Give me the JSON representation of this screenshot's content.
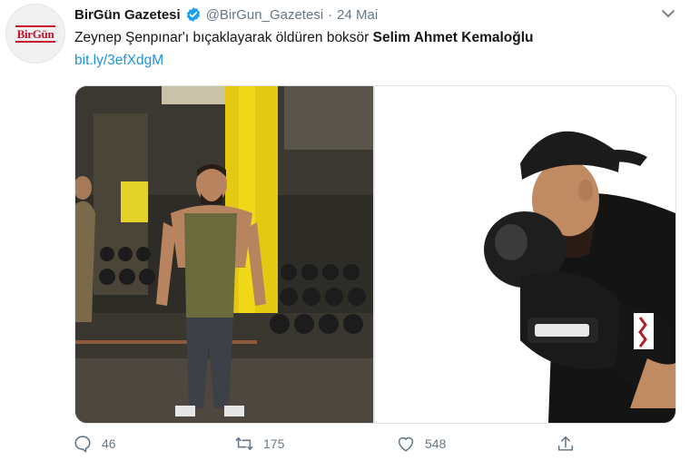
{
  "author": {
    "display_name": "BirGün Gazetesi",
    "handle": "@BirGun_Gazetesi",
    "separator": "·",
    "date": "24 Mai",
    "avatar_text": "BirGün"
  },
  "tweet": {
    "text_prefix": "Zeynep Şenpınar'ı bıçaklayarak öldüren boksör ",
    "text_bold": "Selim Ahmet Kemaloğlu",
    "link": "bit.ly/3efXdgM"
  },
  "actions": {
    "replies": "46",
    "retweets": "175",
    "likes": "548"
  },
  "colors": {
    "link": "#1b95e0",
    "secondary_text": "#657786",
    "verified": "#1da1f2",
    "brand_red": "#c8102e"
  },
  "icons": [
    "verified-badge-icon",
    "caret-down-icon",
    "reply-icon",
    "retweet-icon",
    "like-icon",
    "share-icon"
  ]
}
